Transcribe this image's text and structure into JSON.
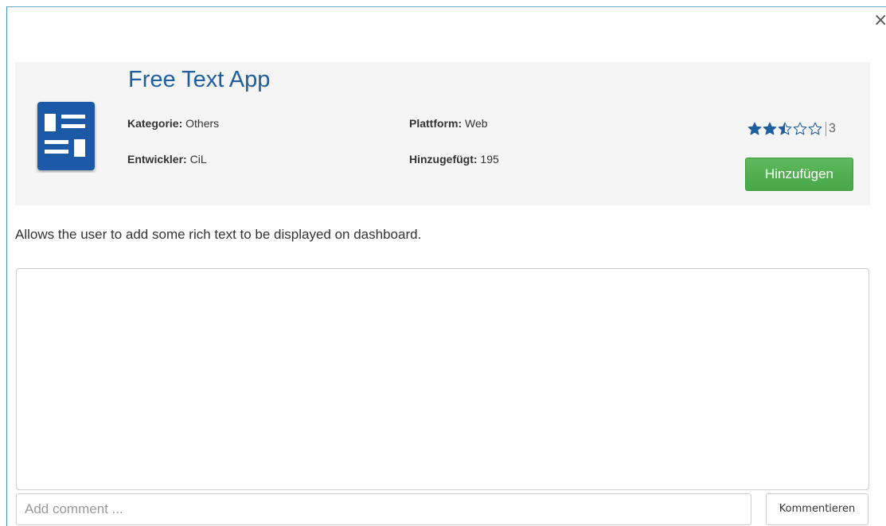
{
  "app": {
    "title": "Free Text App",
    "kategorie_label": "Kategorie:",
    "kategorie_value": "Others",
    "entwickler_label": "Entwickler:",
    "entwickler_value": "CiL",
    "plattform_label": "Plattform:",
    "plattform_value": "Web",
    "hinzugefuegt_label": "Hinzugefügt:",
    "hinzugefuegt_value": "195",
    "rating": 2.5,
    "rating_max": 5,
    "rating_count": "3",
    "add_button": "Hinzufügen",
    "description": "Allows the user to add some rich text to be displayed on dashboard."
  },
  "comments": {
    "input_placeholder": "Add comment ...",
    "submit_label": "Kommentieren"
  },
  "colors": {
    "title": "#1f5f9e",
    "icon_bg": "#1e5aa8",
    "star": "#1f5f9e",
    "add_button": "#5cb85c"
  },
  "icons": {
    "close": "close-icon",
    "app": "app-icon",
    "star_full": "star-full-icon",
    "star_half": "star-half-icon",
    "star_empty": "star-empty-icon"
  }
}
